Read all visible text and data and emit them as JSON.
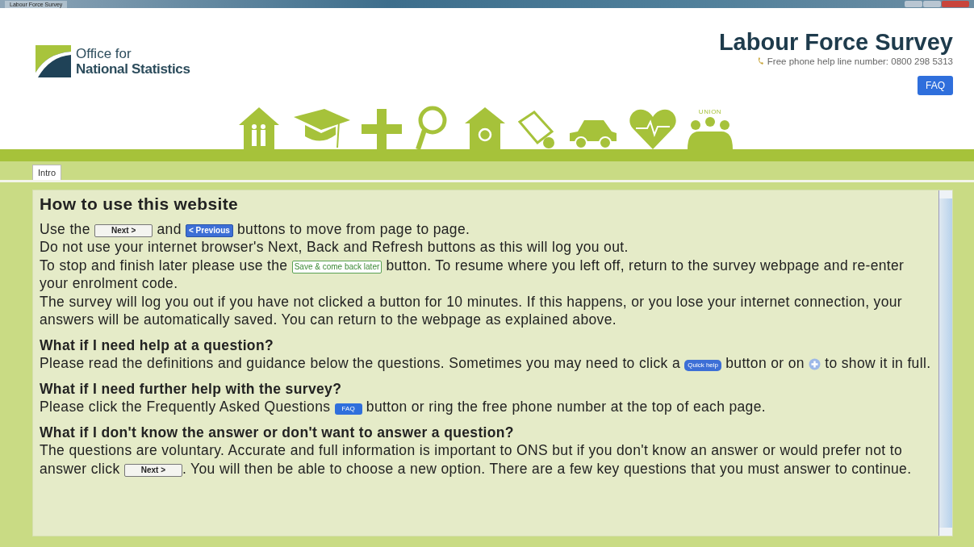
{
  "window": {
    "title": "Labour Force Survey"
  },
  "header": {
    "logo_line_1": "Office for",
    "logo_line_2": "National Statistics",
    "title": "Labour Force Survey",
    "phone": "Free phone help line number: 0800 298 5313",
    "faq_button": "FAQ",
    "union_label": "UNION"
  },
  "tabs": [
    {
      "label": "Intro",
      "selected": true
    }
  ],
  "content": {
    "heading": "How to use this website",
    "sections": [
      {
        "paragraphs": [
          [
            {
              "kind": "text",
              "text": "Use the "
            },
            {
              "kind": "next",
              "text": "Next >"
            },
            {
              "kind": "text",
              "text": " and "
            },
            {
              "kind": "previous",
              "text": "< Previous"
            },
            {
              "kind": "text",
              "text": " buttons to move from page to page."
            }
          ],
          [
            {
              "kind": "text",
              "text": "Do not use your internet browser's Next, Back and Refresh buttons as this will log you out."
            }
          ],
          [
            {
              "kind": "text",
              "text": "To stop and finish later please use the "
            },
            {
              "kind": "save",
              "text": "Save & come back later"
            },
            {
              "kind": "text",
              "text": " button. To resume where you left off, return to the survey webpage and re-enter your enrolment code."
            }
          ],
          [
            {
              "kind": "text",
              "text": "The survey will log you out if you have not clicked a button for 10 minutes. If this happens, or you lose your internet connection, your answers will be automatically saved. You can return to the webpage as explained above."
            }
          ]
        ]
      },
      {
        "title": "What if I need help at a question?",
        "paragraphs": [
          [
            {
              "kind": "text",
              "text": "Please read the definitions and guidance below the questions. Sometimes you may need to click a "
            },
            {
              "kind": "quickhelp",
              "text": "Quick help"
            },
            {
              "kind": "text",
              "text": " button or on "
            },
            {
              "kind": "plus"
            },
            {
              "kind": "text",
              "text": " to show it in full."
            }
          ]
        ]
      },
      {
        "title": "What if I need further help with the survey?",
        "paragraphs": [
          [
            {
              "kind": "text",
              "text": "Please click the Frequently Asked Questions "
            },
            {
              "kind": "faq",
              "text": "FAQ"
            },
            {
              "kind": "text",
              "text": " button or ring the free phone number at the top of each page."
            }
          ]
        ]
      },
      {
        "title": "What if I don't know the answer or don't want to answer a question?",
        "paragraphs": [
          [
            {
              "kind": "text",
              "text": "The questions are voluntary. Accurate and full information is important to ONS but if you don't know an answer or would prefer not to answer click "
            },
            {
              "kind": "next",
              "text": "Next >"
            },
            {
              "kind": "text",
              "text": ". You will then be able to choose a new option. There are a few key questions that you must answer to continue."
            }
          ]
        ]
      }
    ]
  }
}
